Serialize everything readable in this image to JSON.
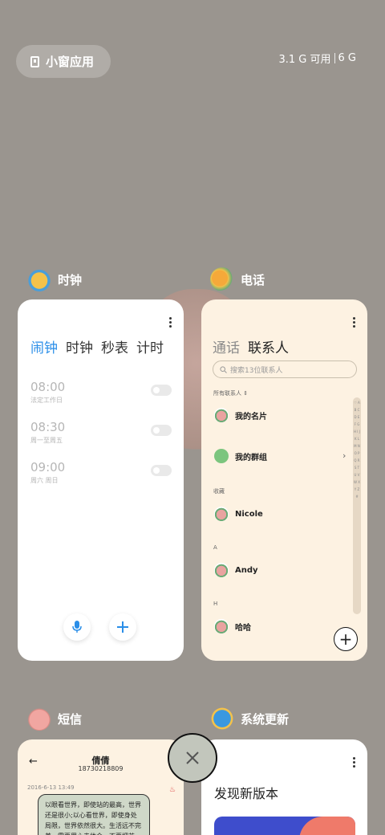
{
  "header": {
    "floating_window_label": "小窗应用",
    "memory_available": "3.1 G 可用",
    "memory_total": "6 G"
  },
  "apps": {
    "clock": {
      "label": "时钟",
      "tabs": [
        "闹钟",
        "时钟",
        "秒表",
        "计时"
      ],
      "alarms": [
        {
          "time": "08:00",
          "repeat": "法定工作日"
        },
        {
          "time": "08:30",
          "repeat": "周一至周五"
        },
        {
          "time": "09:00",
          "repeat": "周六 周日"
        }
      ]
    },
    "phone": {
      "label": "电话",
      "tabs": [
        "通话",
        "联系人"
      ],
      "search_placeholder": "搜索13位联系人",
      "all_contacts": "所有联系人",
      "my_card": "我的名片",
      "my_groups": "我的群组",
      "sections": [
        "收藏",
        "A",
        "H"
      ],
      "contacts": [
        "Nicole",
        "Andy",
        "哈哈"
      ],
      "alphabet": "♡ A B C D E F G H I J K L M N O P Q R S T U V W X Y Z #"
    },
    "sms": {
      "label": "短信",
      "contact_name": "倩倩",
      "phone_number": "18730218809",
      "date": "2016-6-13 13:49",
      "message": "以眼看世界，即使站的最高，世界还是很小;以心看世界，即使身处局限，世界依然很大。生活远不完美，需要用心去体会。不要把苦..."
    },
    "update": {
      "label": "系统更新",
      "title": "发现新版本"
    }
  },
  "colors": {
    "background": "#9a958f",
    "accent_blue": "#2a8ee8",
    "contacts_bg": "#fdf2e2"
  }
}
